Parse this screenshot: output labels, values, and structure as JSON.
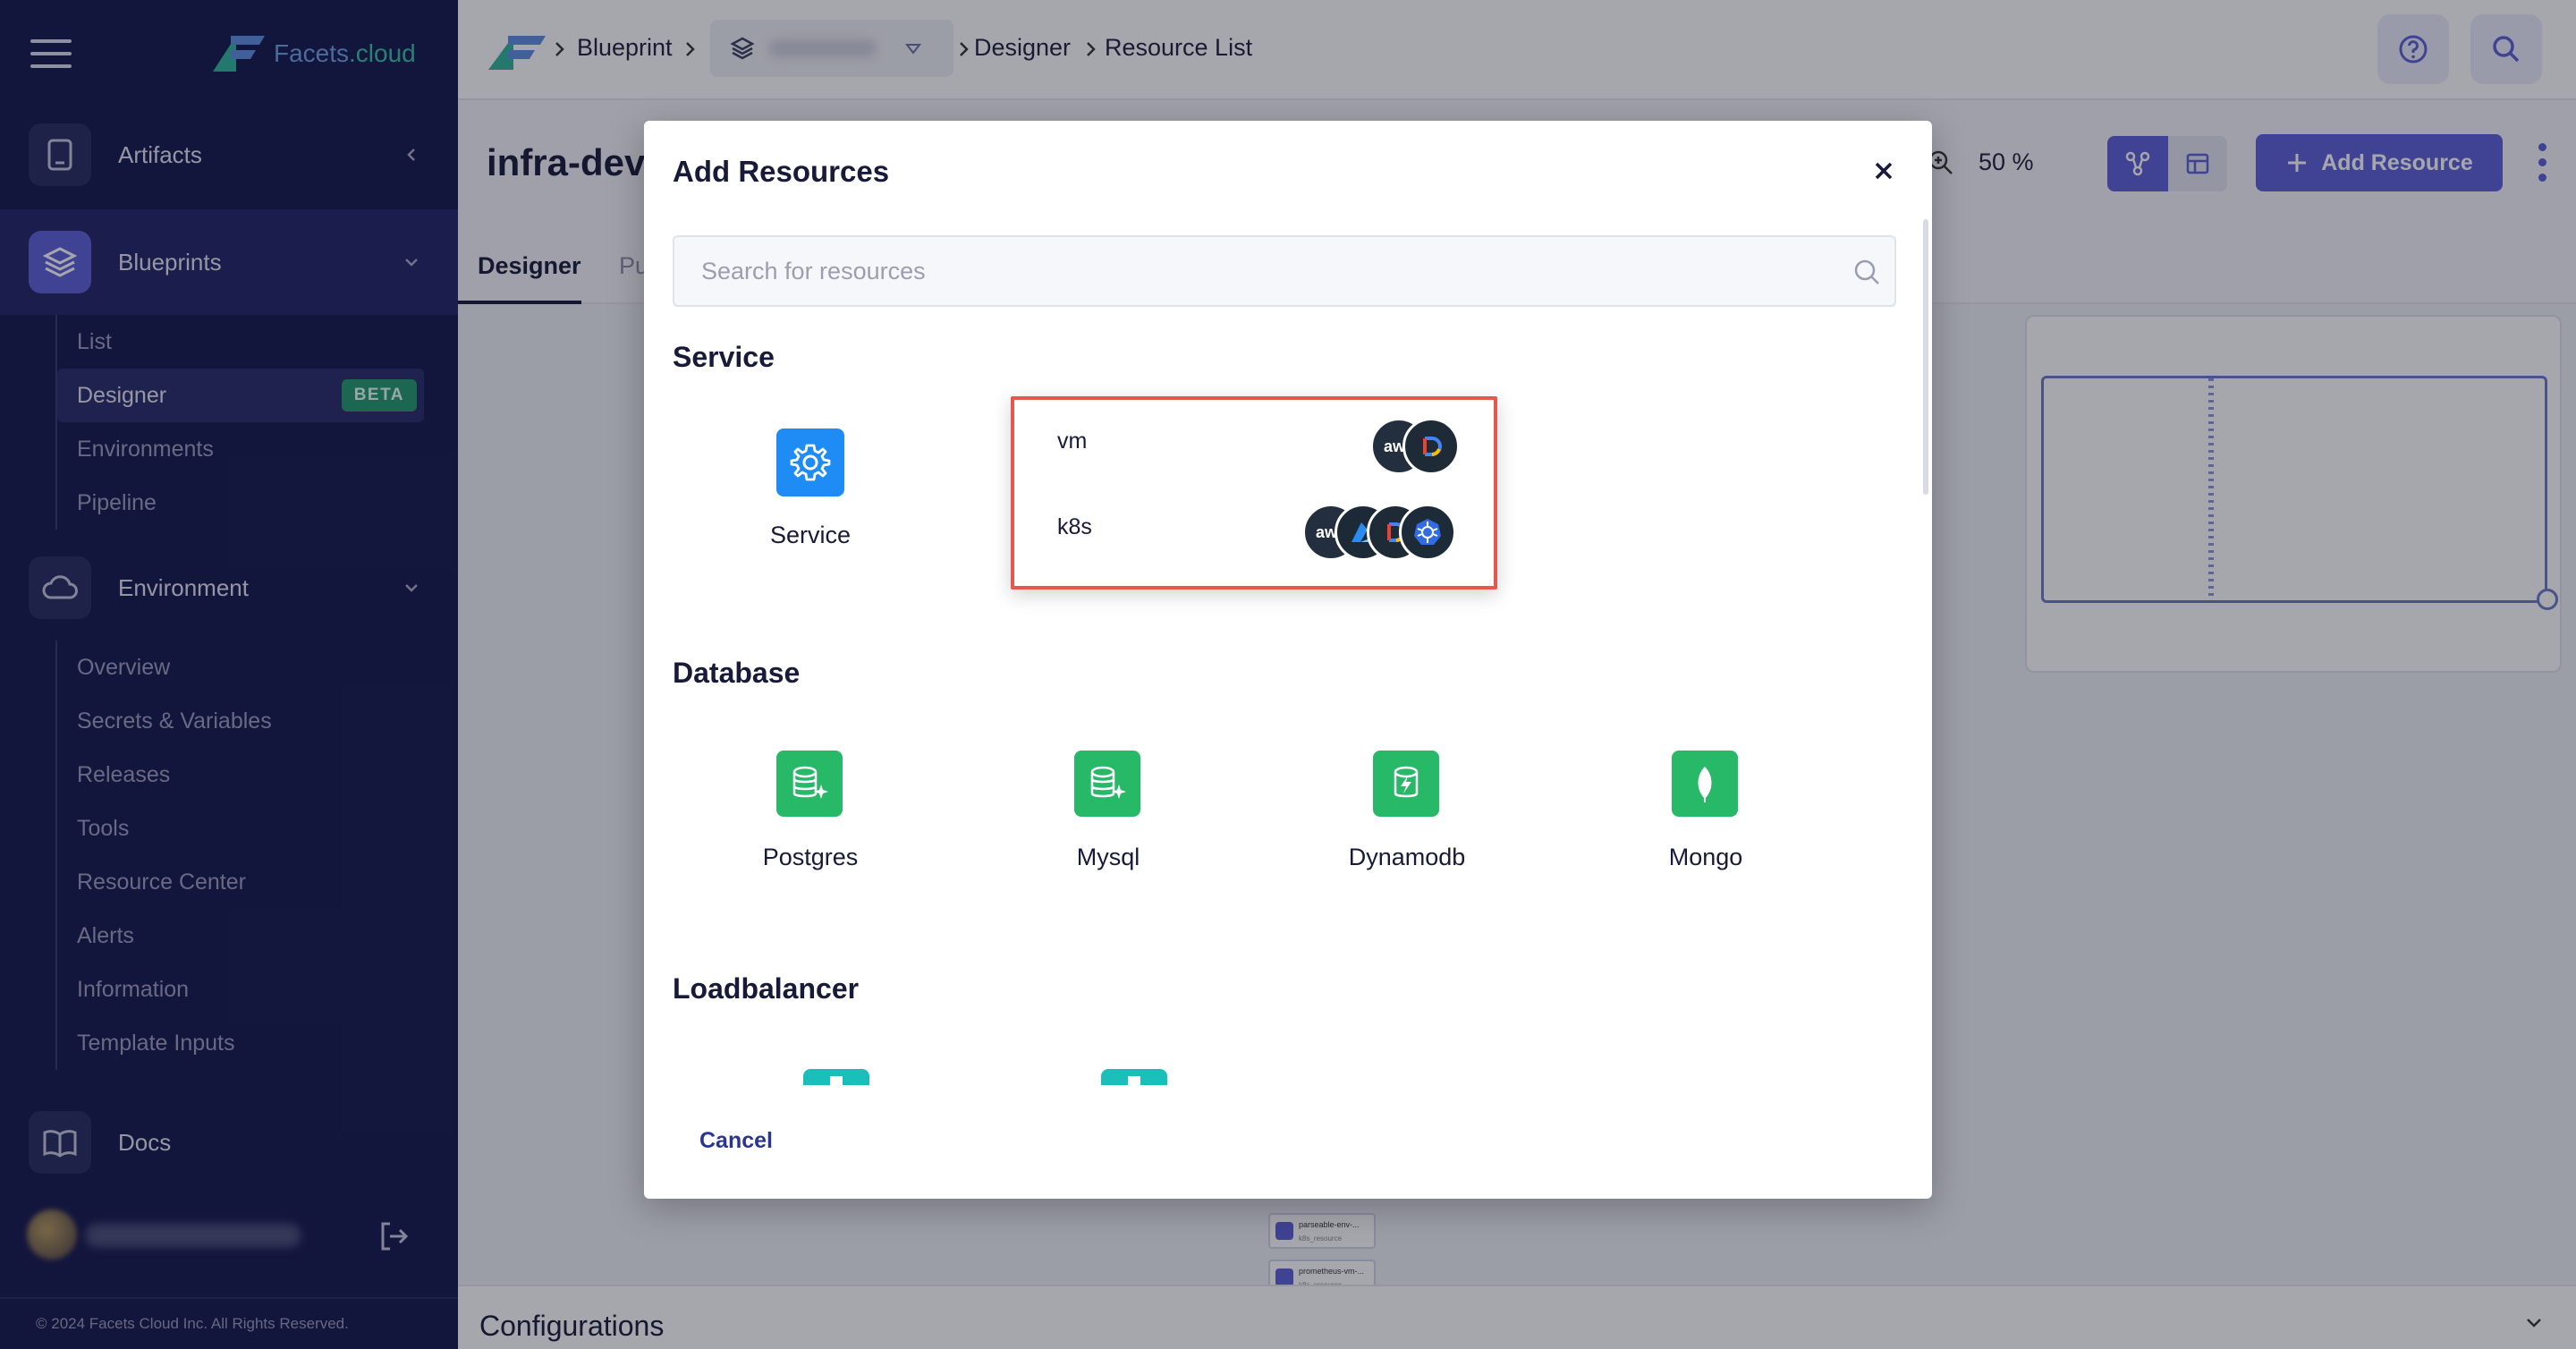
{
  "sidebar": {
    "logo_text_brand": "Facets",
    "logo_text_suffix": ".cloud",
    "items": [
      {
        "label": "Artifacts"
      },
      {
        "label": "Blueprints"
      },
      {
        "label": "Environment"
      },
      {
        "label": "Docs"
      }
    ],
    "blueprints_sub": [
      {
        "label": "List"
      },
      {
        "label": "Designer",
        "badge": "BETA"
      },
      {
        "label": "Environments"
      },
      {
        "label": "Pipeline"
      }
    ],
    "environment_sub": [
      {
        "label": "Overview"
      },
      {
        "label": "Secrets & Variables"
      },
      {
        "label": "Releases"
      },
      {
        "label": "Tools"
      },
      {
        "label": "Resource Center"
      },
      {
        "label": "Alerts"
      },
      {
        "label": "Information"
      },
      {
        "label": "Template Inputs"
      }
    ],
    "copyright": "© 2024 Facets Cloud Inc. All Rights Reserved."
  },
  "header": {
    "breadcrumb": {
      "blueprint": "Blueprint",
      "designer": "Designer",
      "resource_list": "Resource List"
    }
  },
  "page": {
    "title": "infra-dev",
    "zoom": "50 %",
    "add_resource_label": "Add Resource",
    "tabs": [
      {
        "label": "Designer"
      },
      {
        "label": "Pu"
      }
    ],
    "nodes": [
      {
        "title": "parseable-env-...",
        "sub": "k8s_resource"
      },
      {
        "title": "prometheus-vm-...",
        "sub": "k8s_resource"
      }
    ],
    "configurations_label": "Configurations"
  },
  "modal": {
    "title": "Add Resources",
    "search_placeholder": "Search for resources",
    "sections": [
      {
        "title": "Service",
        "items": [
          {
            "label": "Service",
            "icon": "gear-icon"
          }
        ]
      },
      {
        "title": "Database",
        "items": [
          {
            "label": "Postgres",
            "icon": "database-sparkle-icon"
          },
          {
            "label": "Mysql",
            "icon": "database-sparkle-icon"
          },
          {
            "label": "Dynamodb",
            "icon": "database-bolt-icon"
          },
          {
            "label": "Mongo",
            "icon": "leaf-icon"
          }
        ]
      },
      {
        "title": "Loadbalancer",
        "items": []
      }
    ],
    "flavors": [
      {
        "name": "vm",
        "clouds": [
          "aws",
          "gcp"
        ]
      },
      {
        "name": "k8s",
        "clouds": [
          "aws",
          "azure",
          "gcp",
          "kubernetes"
        ]
      }
    ],
    "cloud_labels": {
      "aws": "aws"
    },
    "cancel_label": "Cancel"
  },
  "colors": {
    "sidebar_bg": "#13174a",
    "accent": "#5b5fd6",
    "highlight_border": "#e5584d",
    "db_green": "#27b868",
    "service_blue": "#1f8bf5"
  }
}
